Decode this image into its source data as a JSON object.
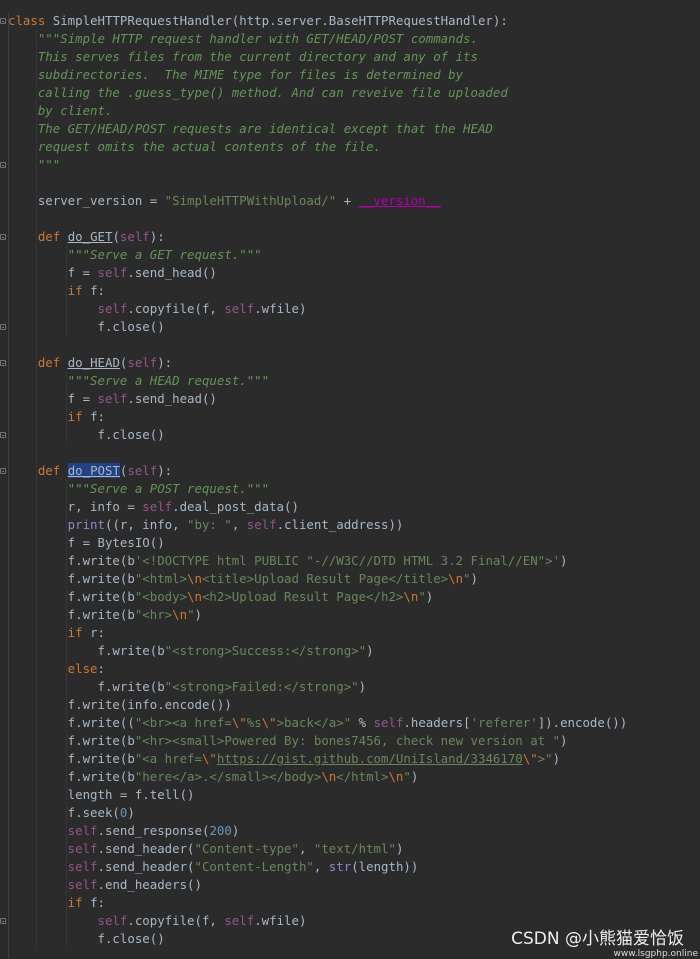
{
  "code": {
    "lines": [
      [
        [
          "kw",
          "class "
        ],
        [
          "name",
          "SimpleHTTPRequestHandler(http.server.BaseHTTPRequestHandler):"
        ]
      ],
      [
        [
          "doc",
          "    \"\"\"Simple HTTP request handler with GET/HEAD/POST commands."
        ]
      ],
      [
        [
          "doc",
          "    This serves files from the current directory and any of its"
        ]
      ],
      [
        [
          "doc",
          "    subdirectories.  The MIME type for files is determined by"
        ]
      ],
      [
        [
          "doc",
          "    calling the .guess_type() method. And can reveive file uploaded"
        ]
      ],
      [
        [
          "doc",
          "    by client."
        ]
      ],
      [
        [
          "doc",
          "    The GET/HEAD/POST requests are identical except that the HEAD"
        ]
      ],
      [
        [
          "doc",
          "    request omits the actual contents of the file."
        ]
      ],
      [
        [
          "doc",
          "    \"\"\""
        ]
      ],
      [],
      [
        [
          "name",
          "    server_version = "
        ],
        [
          "str",
          "\"SimpleHTTPWithUpload/\""
        ],
        [
          "name",
          " + "
        ],
        [
          "magic",
          "__version__"
        ]
      ],
      [],
      [
        [
          "kw",
          "    def "
        ],
        [
          "deffn",
          "do_GET"
        ],
        [
          "name",
          "("
        ],
        [
          "self",
          "self"
        ],
        [
          "name",
          "):"
        ]
      ],
      [
        [
          "doc",
          "        \"\"\"Serve a GET request.\"\"\""
        ]
      ],
      [
        [
          "name",
          "        f = "
        ],
        [
          "self",
          "self"
        ],
        [
          "name",
          ".send_head()"
        ]
      ],
      [
        [
          "kw",
          "        if "
        ],
        [
          "name",
          "f:"
        ]
      ],
      [
        [
          "self",
          "            self"
        ],
        [
          "name",
          ".copyfile(f, "
        ],
        [
          "self",
          "self"
        ],
        [
          "name",
          ".wfile)"
        ]
      ],
      [
        [
          "name",
          "            f.close()"
        ]
      ],
      [],
      [
        [
          "kw",
          "    def "
        ],
        [
          "deffn",
          "do_HEAD"
        ],
        [
          "name",
          "("
        ],
        [
          "self",
          "self"
        ],
        [
          "name",
          "):"
        ]
      ],
      [
        [
          "doc",
          "        \"\"\"Serve a HEAD request.\"\"\""
        ]
      ],
      [
        [
          "name",
          "        f = "
        ],
        [
          "self",
          "self"
        ],
        [
          "name",
          ".send_head()"
        ]
      ],
      [
        [
          "kw",
          "        if "
        ],
        [
          "name",
          "f:"
        ]
      ],
      [
        [
          "name",
          "            f.close()"
        ]
      ],
      [],
      [
        [
          "kw",
          "    def "
        ],
        [
          "hl",
          "do_POST"
        ],
        [
          "name",
          "("
        ],
        [
          "self",
          "self"
        ],
        [
          "name",
          "):"
        ]
      ],
      [
        [
          "doc",
          "        \"\"\"Serve a POST request.\"\"\""
        ]
      ],
      [
        [
          "name",
          "        r, info = "
        ],
        [
          "self",
          "self"
        ],
        [
          "name",
          ".deal_post_data()"
        ]
      ],
      [
        [
          "builtin",
          "        print"
        ],
        [
          "name",
          "((r, info, "
        ],
        [
          "str",
          "\"by: \""
        ],
        [
          "name",
          ", "
        ],
        [
          "self",
          "self"
        ],
        [
          "name",
          ".client_address))"
        ]
      ],
      [
        [
          "name",
          "        f = BytesIO()"
        ]
      ],
      [
        [
          "name",
          "        f.write(b"
        ],
        [
          "str",
          "'<!DOCTYPE html PUBLIC \"-//W3C//DTD HTML 3.2 Final//EN\">'"
        ],
        [
          "name",
          ")"
        ]
      ],
      [
        [
          "name",
          "        f.write(b"
        ],
        [
          "str",
          "\"<html>"
        ],
        [
          "esc",
          "\\n"
        ],
        [
          "str",
          "<title>Upload Result Page</title>"
        ],
        [
          "esc",
          "\\n"
        ],
        [
          "str",
          "\""
        ],
        [
          "name",
          ")"
        ]
      ],
      [
        [
          "name",
          "        f.write(b"
        ],
        [
          "str",
          "\"<body>"
        ],
        [
          "esc",
          "\\n"
        ],
        [
          "str",
          "<h2>Upload Result Page</h2>"
        ],
        [
          "esc",
          "\\n"
        ],
        [
          "str",
          "\""
        ],
        [
          "name",
          ")"
        ]
      ],
      [
        [
          "name",
          "        f.write(b"
        ],
        [
          "str",
          "\"<hr>"
        ],
        [
          "esc",
          "\\n"
        ],
        [
          "str",
          "\""
        ],
        [
          "name",
          ")"
        ]
      ],
      [
        [
          "kw",
          "        if "
        ],
        [
          "name",
          "r:"
        ]
      ],
      [
        [
          "name",
          "            f.write(b"
        ],
        [
          "str",
          "\"<strong>Success:</strong>\""
        ],
        [
          "name",
          ")"
        ]
      ],
      [
        [
          "kw",
          "        else"
        ],
        [
          "name",
          ":"
        ]
      ],
      [
        [
          "name",
          "            f.write(b"
        ],
        [
          "str",
          "\"<strong>Failed:</strong>\""
        ],
        [
          "name",
          ")"
        ]
      ],
      [
        [
          "name",
          "        f.write(info.encode())"
        ]
      ],
      [
        [
          "name",
          "        f.write(("
        ],
        [
          "str",
          "\"<br><a href="
        ],
        [
          "esc",
          "\\\""
        ],
        [
          "str",
          "%s"
        ],
        [
          "esc",
          "\\\""
        ],
        [
          "str",
          ">back</a>\""
        ],
        [
          "name",
          " % "
        ],
        [
          "self",
          "self"
        ],
        [
          "name",
          ".headers["
        ],
        [
          "str",
          "'referer'"
        ],
        [
          "name",
          "]).encode())"
        ]
      ],
      [
        [
          "name",
          "        f.write(b"
        ],
        [
          "str",
          "\"<hr><small>Powered By: bones7456, check new version at \""
        ],
        [
          "name",
          ")"
        ]
      ],
      [
        [
          "name",
          "        f.write(b"
        ],
        [
          "str",
          "\"<a href="
        ],
        [
          "esc",
          "\\\""
        ],
        [
          "link",
          "https://gist.github.com/UniIsland/3346170"
        ],
        [
          "esc",
          "\\\""
        ],
        [
          "str",
          ">\""
        ],
        [
          "name",
          ")"
        ]
      ],
      [
        [
          "name",
          "        f.write(b"
        ],
        [
          "str",
          "\"here</a>.</small></body>"
        ],
        [
          "esc",
          "\\n"
        ],
        [
          "str",
          "</html>"
        ],
        [
          "esc",
          "\\n"
        ],
        [
          "str",
          "\""
        ],
        [
          "name",
          ")"
        ]
      ],
      [
        [
          "name",
          "        length = f.tell()"
        ]
      ],
      [
        [
          "name",
          "        f.seek("
        ],
        [
          "num",
          "0"
        ],
        [
          "name",
          ")"
        ]
      ],
      [
        [
          "self",
          "        self"
        ],
        [
          "name",
          ".send_response("
        ],
        [
          "num",
          "200"
        ],
        [
          "name",
          ")"
        ]
      ],
      [
        [
          "self",
          "        self"
        ],
        [
          "name",
          ".send_header("
        ],
        [
          "str",
          "\"Content-type\""
        ],
        [
          "name",
          ", "
        ],
        [
          "str",
          "\"text/html\""
        ],
        [
          "name",
          ")"
        ]
      ],
      [
        [
          "self",
          "        self"
        ],
        [
          "name",
          ".send_header("
        ],
        [
          "str",
          "\"Content-Length\""
        ],
        [
          "name",
          ", "
        ],
        [
          "builtin",
          "str"
        ],
        [
          "name",
          "(length))"
        ]
      ],
      [
        [
          "self",
          "        self"
        ],
        [
          "name",
          ".end_headers()"
        ]
      ],
      [
        [
          "kw",
          "        if "
        ],
        [
          "name",
          "f:"
        ]
      ],
      [
        [
          "self",
          "            self"
        ],
        [
          "name",
          ".copyfile(f, "
        ],
        [
          "self",
          "self"
        ],
        [
          "name",
          ".wfile)"
        ]
      ],
      [
        [
          "name",
          "            f.close()"
        ]
      ]
    ],
    "fold_lines": [
      0,
      8,
      12,
      17,
      19,
      23,
      25,
      50
    ]
  },
  "watermark": {
    "text": "CSDN @小熊猫爱恰饭",
    "sub": "www.lsgphp.online"
  },
  "colors": {
    "background": "#2b2b2b",
    "keyword": "#cc7832",
    "docstring": "#629755",
    "string": "#6a8759",
    "self": "#94558d",
    "number": "#6897bb",
    "builtin": "#8888c6",
    "text": "#a9b7c6",
    "magic": "#b200b2",
    "highlight": "#214283"
  }
}
